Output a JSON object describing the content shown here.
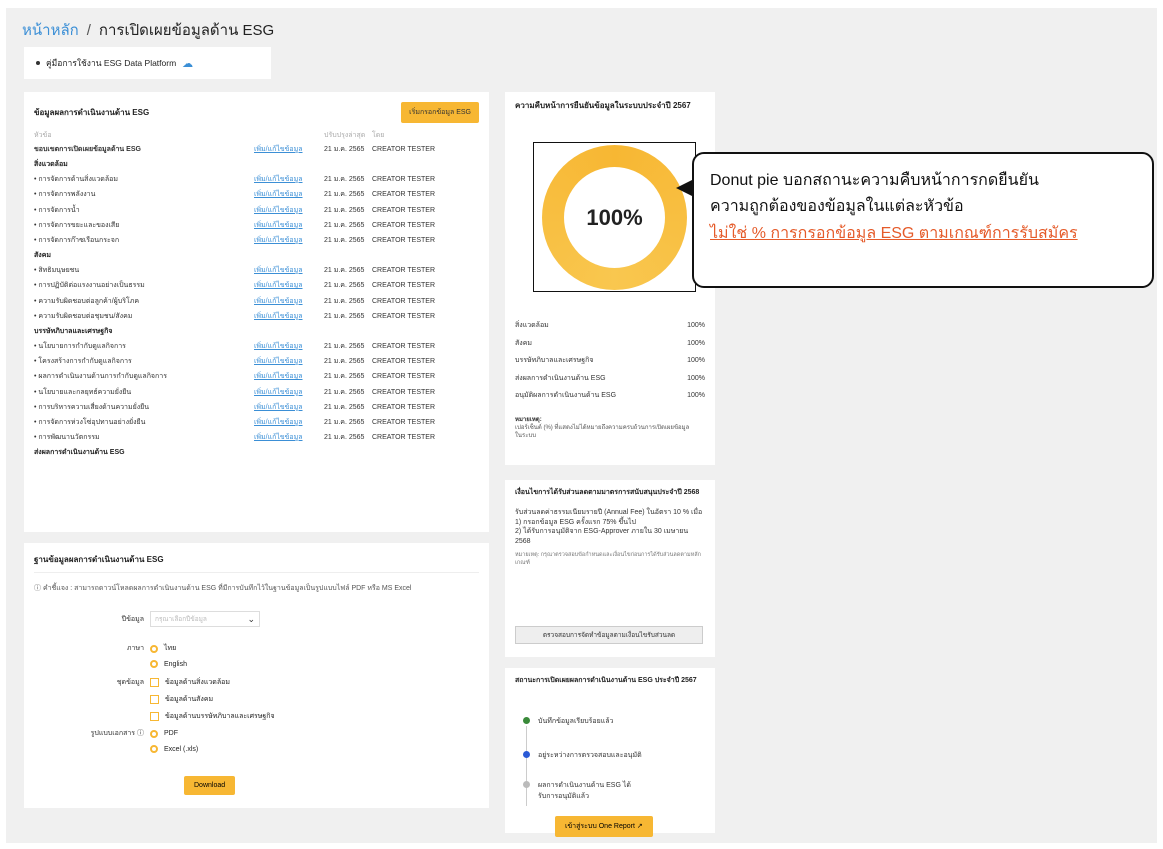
{
  "breadcrumb": {
    "home": "หน้าหลัก",
    "separator": "/",
    "current": "การเปิดเผยข้อมูลด้าน ESG"
  },
  "manual": {
    "label": "คู่มือการใช้งาน ESG Data Platform",
    "icon": "cloud-upload-icon"
  },
  "results": {
    "title": "ข้อมูลผลการดำเนินงานด้าน ESG",
    "start_button": "เริ่มกรอกข้อมูล ESG",
    "columns": [
      "หัวข้อ",
      "",
      "ปรับปรุงล่าสุด",
      "โดย"
    ],
    "overview": {
      "label": "ขอบเขตการเปิดเผยข้อมูลด้าน ESG",
      "link": "เพิ่ม/แก้ไขข้อมูล",
      "date": "21 ม.ค. 2565",
      "user": "CREATOR TESTER"
    },
    "sections": [
      {
        "title": "สิ่งแวดล้อม",
        "items": [
          {
            "label": "การจัดการด้านสิ่งแวดล้อม",
            "link": "เพิ่ม/แก้ไขข้อมูล",
            "date": "21 ม.ค. 2565",
            "user": "CREATOR TESTER"
          },
          {
            "label": "การจัดการพลังงาน",
            "link": "เพิ่ม/แก้ไขข้อมูล",
            "date": "21 ม.ค. 2565",
            "user": "CREATOR TESTER"
          },
          {
            "label": "การจัดการน้ำ",
            "link": "เพิ่ม/แก้ไขข้อมูล",
            "date": "21 ม.ค. 2565",
            "user": "CREATOR TESTER"
          },
          {
            "label": "การจัดการขยะและของเสีย",
            "link": "เพิ่ม/แก้ไขข้อมูล",
            "date": "21 ม.ค. 2565",
            "user": "CREATOR TESTER"
          },
          {
            "label": "การจัดการก๊าซเรือนกระจก",
            "link": "เพิ่ม/แก้ไขข้อมูล",
            "date": "21 ม.ค. 2565",
            "user": "CREATOR TESTER"
          }
        ]
      },
      {
        "title": "สังคม",
        "items": [
          {
            "label": "สิทธิมนุษยชน",
            "link": "เพิ่ม/แก้ไขข้อมูล",
            "date": "21 ม.ค. 2565",
            "user": "CREATOR TESTER"
          },
          {
            "label": "การปฏิบัติต่อแรงงานอย่างเป็นธรรม",
            "link": "เพิ่ม/แก้ไขข้อมูล",
            "date": "21 ม.ค. 2565",
            "user": "CREATOR TESTER"
          },
          {
            "label": "ความรับผิดชอบต่อลูกค้า/ผู้บริโภค",
            "link": "เพิ่ม/แก้ไขข้อมูล",
            "date": "21 ม.ค. 2565",
            "user": "CREATOR TESTER"
          },
          {
            "label": "ความรับผิดชอบต่อชุมชน/สังคม",
            "link": "เพิ่ม/แก้ไขข้อมูล",
            "date": "21 ม.ค. 2565",
            "user": "CREATOR TESTER"
          }
        ]
      },
      {
        "title": "บรรษัทภิบาลและเศรษฐกิจ",
        "items": [
          {
            "label": "นโยบายการกำกับดูแลกิจการ",
            "link": "เพิ่ม/แก้ไขข้อมูล",
            "date": "21 ม.ค. 2565",
            "user": "CREATOR TESTER"
          },
          {
            "label": "โครงสร้างการกำกับดูแลกิจการ",
            "link": "เพิ่ม/แก้ไขข้อมูล",
            "date": "21 ม.ค. 2565",
            "user": "CREATOR TESTER"
          },
          {
            "label": "ผลการดำเนินงานด้านการกำกับดูแลกิจการ",
            "link": "เพิ่ม/แก้ไขข้อมูล",
            "date": "21 ม.ค. 2565",
            "user": "CREATOR TESTER"
          },
          {
            "label": "นโยบายและกลยุทธ์ความยั่งยืน",
            "link": "เพิ่ม/แก้ไขข้อมูล",
            "date": "21 ม.ค. 2565",
            "user": "CREATOR TESTER"
          },
          {
            "label": "การบริหารความเสี่ยงด้านความยั่งยืน",
            "link": "เพิ่ม/แก้ไขข้อมูล",
            "date": "21 ม.ค. 2565",
            "user": "CREATOR TESTER"
          },
          {
            "label": "การจัดการห่วงโซ่อุปทานอย่างยั่งยืน",
            "link": "เพิ่ม/แก้ไขข้อมูล",
            "date": "21 ม.ค. 2565",
            "user": "CREATOR TESTER"
          },
          {
            "label": "การพัฒนานวัตกรรม",
            "link": "เพิ่ม/แก้ไขข้อมูล",
            "date": "21 ม.ค. 2565",
            "user": "CREATOR TESTER"
          }
        ]
      }
    ],
    "footer_section": "ส่งผลการดำเนินงานด้าน ESG"
  },
  "database": {
    "title": "ฐานข้อมูลผลการดำเนินงานด้าน ESG",
    "note": "ⓘ คำชี้แจง : สามารถดาวน์โหลดผลการดำเนินงานด้าน ESG ที่มีการบันทึกไว้ในฐานข้อมูลเป็นรูปแบบไฟล์ PDF หรือ MS Excel",
    "year_label": "ปีข้อมูล",
    "year_placeholder": "กรุณาเลือกปีข้อมูล",
    "language_label": "ภาษา",
    "lang_options": [
      "ไทย",
      "English"
    ],
    "dataset_label": "ชุดข้อมูล",
    "dataset_options": [
      "ข้อมูลด้านสิ่งแวดล้อม",
      "ข้อมูลด้านสังคม",
      "ข้อมูลด้านบรรษัทภิบาลและเศรษฐกิจ"
    ],
    "format_label": "รูปแบบเอกสาร ⓘ",
    "format_options": [
      "PDF",
      "Excel (.xls)"
    ],
    "download_button": "Download"
  },
  "progress": {
    "title": "ความคืบหน้าการยืนยันข้อมูลในระบบประจำปี 2567",
    "percent": "100%",
    "percent_value": 100,
    "categories": [
      {
        "name": "สิ่งแวดล้อม",
        "value": "100%"
      },
      {
        "name": "สังคม",
        "value": "100%"
      },
      {
        "name": "บรรษัทภิบาลและเศรษฐกิจ",
        "value": "100%"
      },
      {
        "name": "ส่งผลการดำเนินงานด้าน ESG",
        "value": "100%"
      },
      {
        "name": "อนุมัติผลการดำเนินงานด้าน ESG",
        "value": "100%"
      }
    ],
    "note_title": "หมายเหตุ:",
    "note_text": "เปอร์เซ็นต์ (%) ที่แสดงไม่ได้หมายถึงความครบถ้วนการเปิดเผยข้อมูลในระบบ"
  },
  "annotation": {
    "line1": "Donut pie บอกสถานะความคืบหน้าการกดยืนยัน",
    "line2": "ความถูกต้องของข้อมูลในแต่ละหัวข้อ",
    "line3": "ไม่ใช่ % การกรอกข้อมูล ESG ตามเกณฑ์การรับสมัคร"
  },
  "fee": {
    "title": "เงื่อนไขการได้รับส่วนลดตามมาตรการสนับสนุนประจำปี 2568",
    "text1": "รับส่วนลดค่าธรรมเนียมรายปี (Annual Fee) ในอัตรา 10 % เมื่อ",
    "text2": "1) กรอกข้อมูล ESG ครั้งแรก 75% ขึ้นไป",
    "text3": "2) ได้รับการอนุมัติจาก ESG-Approver ภายใน 30 เมษายน 2568",
    "small": "หมายเหตุ: กรุณาตรวจสอบข้อกำหนดและเงื่อนไขก่อนการได้รับส่วนลดตามหลักเกณฑ์",
    "button": "ตรวจสอบการจัดทำข้อมูลตามเงื่อนไขรับส่วนลด"
  },
  "status": {
    "title": "สถานะการเปิดเผยผลการดำเนินงานด้าน ESG ประจำปี 2567",
    "steps": [
      "บันทึกข้อมูลเรียบร้อยแล้ว",
      "อยู่ระหว่างการตรวจสอบและอนุมัติ",
      "ผลการดำเนินงานด้าน ESG ได้รับการอนุมัติแล้ว"
    ],
    "button": "เข้าสู่ระบบ One Report ↗"
  },
  "colors": {
    "accent": "#f7b733",
    "link": "#3b8fd6",
    "annotation_red": "#e55b2a",
    "done": "#3a8a3a",
    "current": "#2a5ad6",
    "pending": "#bbbbbb"
  }
}
